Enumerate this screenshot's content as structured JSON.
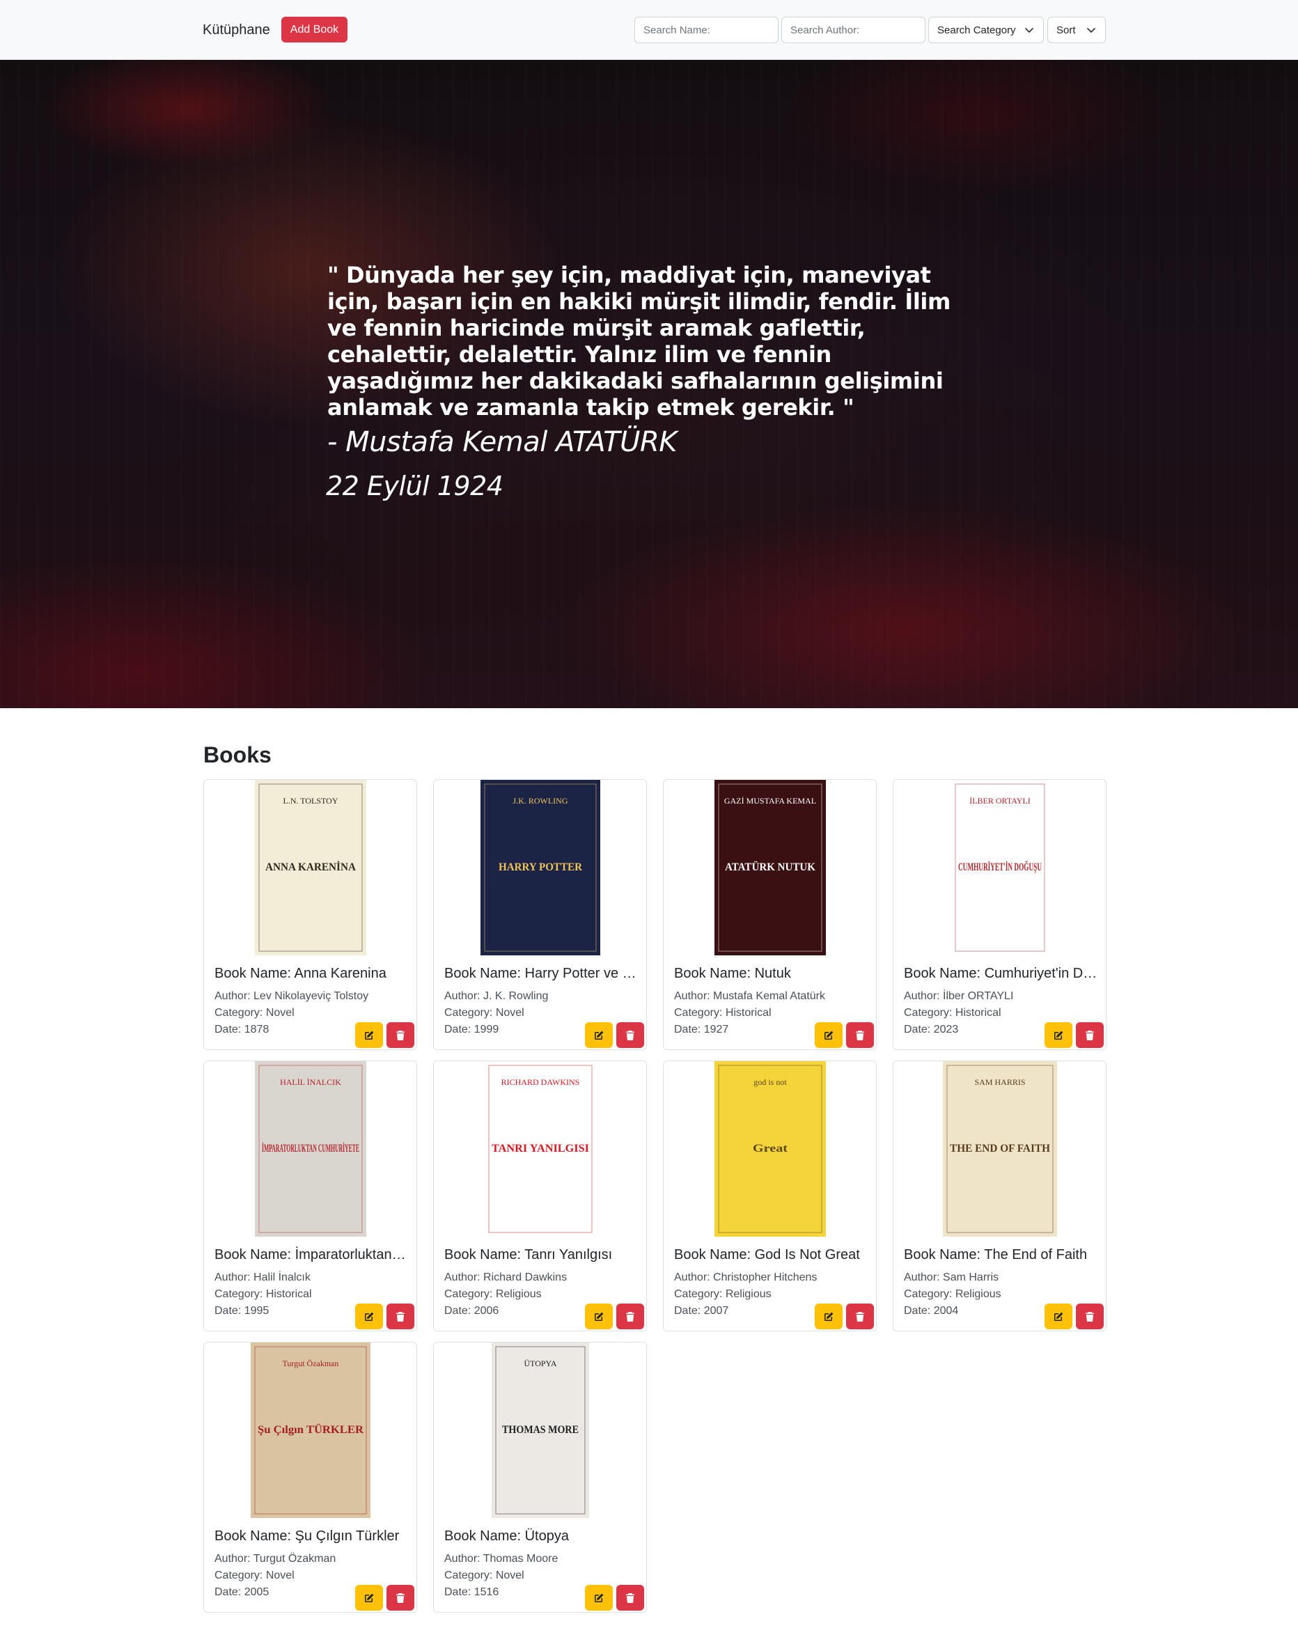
{
  "navbar": {
    "brand": "Kütüphane",
    "add_book_label": "Add Book",
    "search_name_placeholder": "Search Name:",
    "search_author_placeholder": "Search Author:",
    "search_category_label": "Search Category",
    "sort_label": "Sort"
  },
  "hero": {
    "quote": "\" Dünyada her şey için, maddiyat için, maneviyat için, başarı için en hakiki mürşit ilimdir, fendir. İlim ve fennin haricinde mürşit aramak gaflettir, cehalettir, delalettir. Yalnız ilim ve fennin yaşadığımız her dakikadaki safhalarının gelişimini anlamak ve zamanla takip etmek gerekir. \"",
    "author": "- Mustafa Kemal ATATÜRK",
    "date": "22 Eylül 1924"
  },
  "books_section": {
    "title": "Books",
    "books": [
      {
        "name_label": "Book Name: Anna Karenina",
        "author_label": "Author: Lev Nikolayeviç Tolstoy",
        "category_label": "Category: Novel",
        "date_label": "Date: 1878",
        "cover": {
          "top": "L.N. TOLSTOY",
          "title": "ANNA KARENİNA",
          "bg": "#f3ecd6",
          "fg": "#2f2a20"
        }
      },
      {
        "name_label": "Book Name: Harry Potter ve Felsefe Taşı",
        "author_label": "Author: J. K. Rowling",
        "category_label": "Category: Novel",
        "date_label": "Date: 1999",
        "cover": {
          "top": "J.K. ROWLING",
          "title": "HARRY POTTER",
          "bg": "#1c2446",
          "fg": "#f0c35a"
        }
      },
      {
        "name_label": "Book Name: Nutuk",
        "author_label": "Author: Mustafa Kemal Atatürk",
        "category_label": "Category: Historical",
        "date_label": "Date: 1927",
        "cover": {
          "top": "GAZİ MUSTAFA KEMAL",
          "title": "ATATÜRK NUTUK",
          "bg": "#3a1012",
          "fg": "#ffffff"
        }
      },
      {
        "name_label": "Book Name: Cumhuriyet'in Doğuşu",
        "author_label": "Author: İlber ORTAYLI",
        "category_label": "Category: Historical",
        "date_label": "Date: 2023",
        "cover": {
          "top": "İLBER ORTAYLI",
          "title": "CUMHURİYET'İN DOĞUŞU",
          "bg": "#ffffff",
          "fg": "#b3242b"
        }
      },
      {
        "name_label": "Book Name: İmparatorluktan Cumhuriyete",
        "author_label": "Author: Halil İnalcık",
        "category_label": "Category: Historical",
        "date_label": "Date: 1995",
        "cover": {
          "top": "HALİL İNALCIK",
          "title": "İMPARATORLUKTAN CUMHURİYETE",
          "bg": "#d9d6d0",
          "fg": "#b3242b"
        }
      },
      {
        "name_label": "Book Name: Tanrı Yanılgısı",
        "author_label": "Author: Richard Dawkins",
        "category_label": "Category: Religious",
        "date_label": "Date: 2006",
        "cover": {
          "top": "RICHARD DAWKINS",
          "title": "TANRI YANILGISI",
          "bg": "#ffffff",
          "fg": "#d71920"
        }
      },
      {
        "name_label": "Book Name: God Is Not Great",
        "author_label": "Author: Christopher Hitchens",
        "category_label": "Category: Religious",
        "date_label": "Date: 2007",
        "cover": {
          "top": "god is not",
          "title": "Great",
          "bg": "#f5d33b",
          "fg": "#5a4a12"
        }
      },
      {
        "name_label": "Book Name: The End of Faith",
        "author_label": "Author: Sam Harris",
        "category_label": "Category: Religious",
        "date_label": "Date: 2004",
        "cover": {
          "top": "SAM HARRIS",
          "title": "THE END OF FAITH",
          "bg": "#efe4c8",
          "fg": "#5b3b1c"
        }
      },
      {
        "name_label": "Book Name: Şu Çılgın Türkler",
        "author_label": "Author: Turgut Özakman",
        "category_label": "Category: Novel",
        "date_label": "Date: 2005",
        "cover": {
          "top": "Turgut Özakman",
          "title": "Şu Çılgın TÜRKLER",
          "bg": "#d9c3a0",
          "fg": "#a41e22"
        }
      },
      {
        "name_label": "Book Name: Ütopya",
        "author_label": "Author: Thomas Moore",
        "category_label": "Category: Novel",
        "date_label": "Date: 1516",
        "cover": {
          "top": "ÜTOPYA",
          "title": "THOMAS MORE",
          "bg": "#ece8e4",
          "fg": "#222222"
        }
      }
    ]
  },
  "colors": {
    "danger": "#dc3545",
    "warning": "#ffc107",
    "navbar_bg": "#f8f9fa"
  }
}
